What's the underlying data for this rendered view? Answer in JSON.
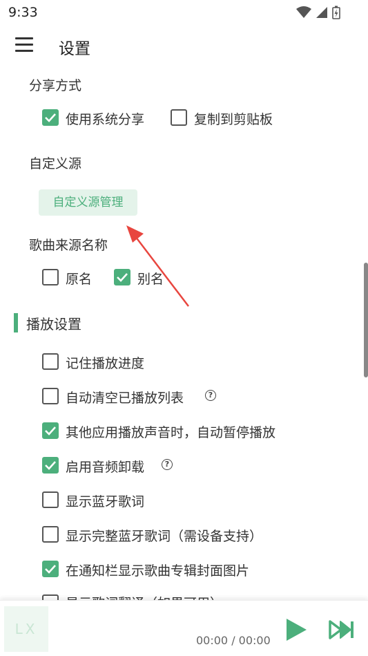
{
  "status_bar": {
    "time": "9:33"
  },
  "app_bar": {
    "title": "设置"
  },
  "share": {
    "label": "分享方式",
    "options": [
      {
        "text": "使用系统分享",
        "checked": true
      },
      {
        "text": "复制到剪贴板",
        "checked": false
      }
    ]
  },
  "custom_source": {
    "label": "自定义源",
    "button": "自定义源管理"
  },
  "source_name": {
    "label": "歌曲来源名称",
    "options": [
      {
        "text": "原名",
        "checked": false
      },
      {
        "text": "别名",
        "checked": true
      }
    ]
  },
  "playback": {
    "title": "播放设置",
    "items": [
      {
        "text": "记住播放进度",
        "checked": false,
        "help": false
      },
      {
        "text": "自动清空已播放列表",
        "checked": false,
        "help": true
      },
      {
        "text": "其他应用播放声音时，自动暂停播放",
        "checked": true,
        "help": false
      },
      {
        "text": "启用音频卸载",
        "checked": true,
        "help": true
      },
      {
        "text": "显示蓝牙歌词",
        "checked": false,
        "help": false
      },
      {
        "text": "显示完整蓝牙歌词（需设备支持）",
        "checked": false,
        "help": false
      },
      {
        "text": "在通知栏显示歌曲专辑封面图片",
        "checked": true,
        "help": false
      },
      {
        "text": "显示歌词翻译（如果可用）",
        "checked": false,
        "help": false
      }
    ]
  },
  "player": {
    "cover_text": "LX",
    "time": "00:00 / 00:00"
  },
  "colors": {
    "accent": "#4caf7c",
    "accent_light": "#e4f3ea",
    "arrow": "#e8463f"
  }
}
